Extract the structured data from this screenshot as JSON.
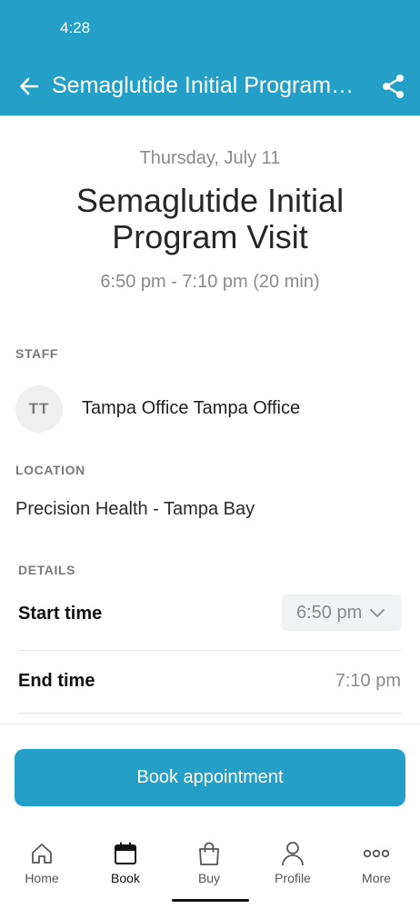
{
  "status_bar": {
    "time": "4:28"
  },
  "app_bar": {
    "title": "Semaglutide Initial Program…",
    "back_icon": "arrow-left-icon",
    "share_icon": "share-icon"
  },
  "appointment": {
    "date": "Thursday, July 11",
    "title": "Semaglutide Initial Program Visit",
    "time_range": "6:50 pm - 7:10 pm (20 min)"
  },
  "staff": {
    "label": "STAFF",
    "initials": "TT",
    "name": "Tampa Office Tampa Office"
  },
  "location": {
    "label": "LOCATION",
    "name": "Precision Health - Tampa Bay"
  },
  "details": {
    "label": "DETAILS",
    "start_time_label": "Start time",
    "start_time_value": "6:50 pm",
    "end_time_label": "End time",
    "end_time_value": "7:10 pm"
  },
  "book_button": {
    "label": "Book appointment"
  },
  "bottom_nav": {
    "items": [
      {
        "label": "Home",
        "icon": "home-icon"
      },
      {
        "label": "Book",
        "icon": "calendar-icon",
        "active": true
      },
      {
        "label": "Buy",
        "icon": "shopping-bag-icon"
      },
      {
        "label": "Profile",
        "icon": "person-icon"
      },
      {
        "label": "More",
        "icon": "more-dots-icon"
      }
    ]
  },
  "colors": {
    "primary": "#249fc7",
    "muted_text": "#8a8a8a",
    "select_bg": "#f0f2f3"
  }
}
